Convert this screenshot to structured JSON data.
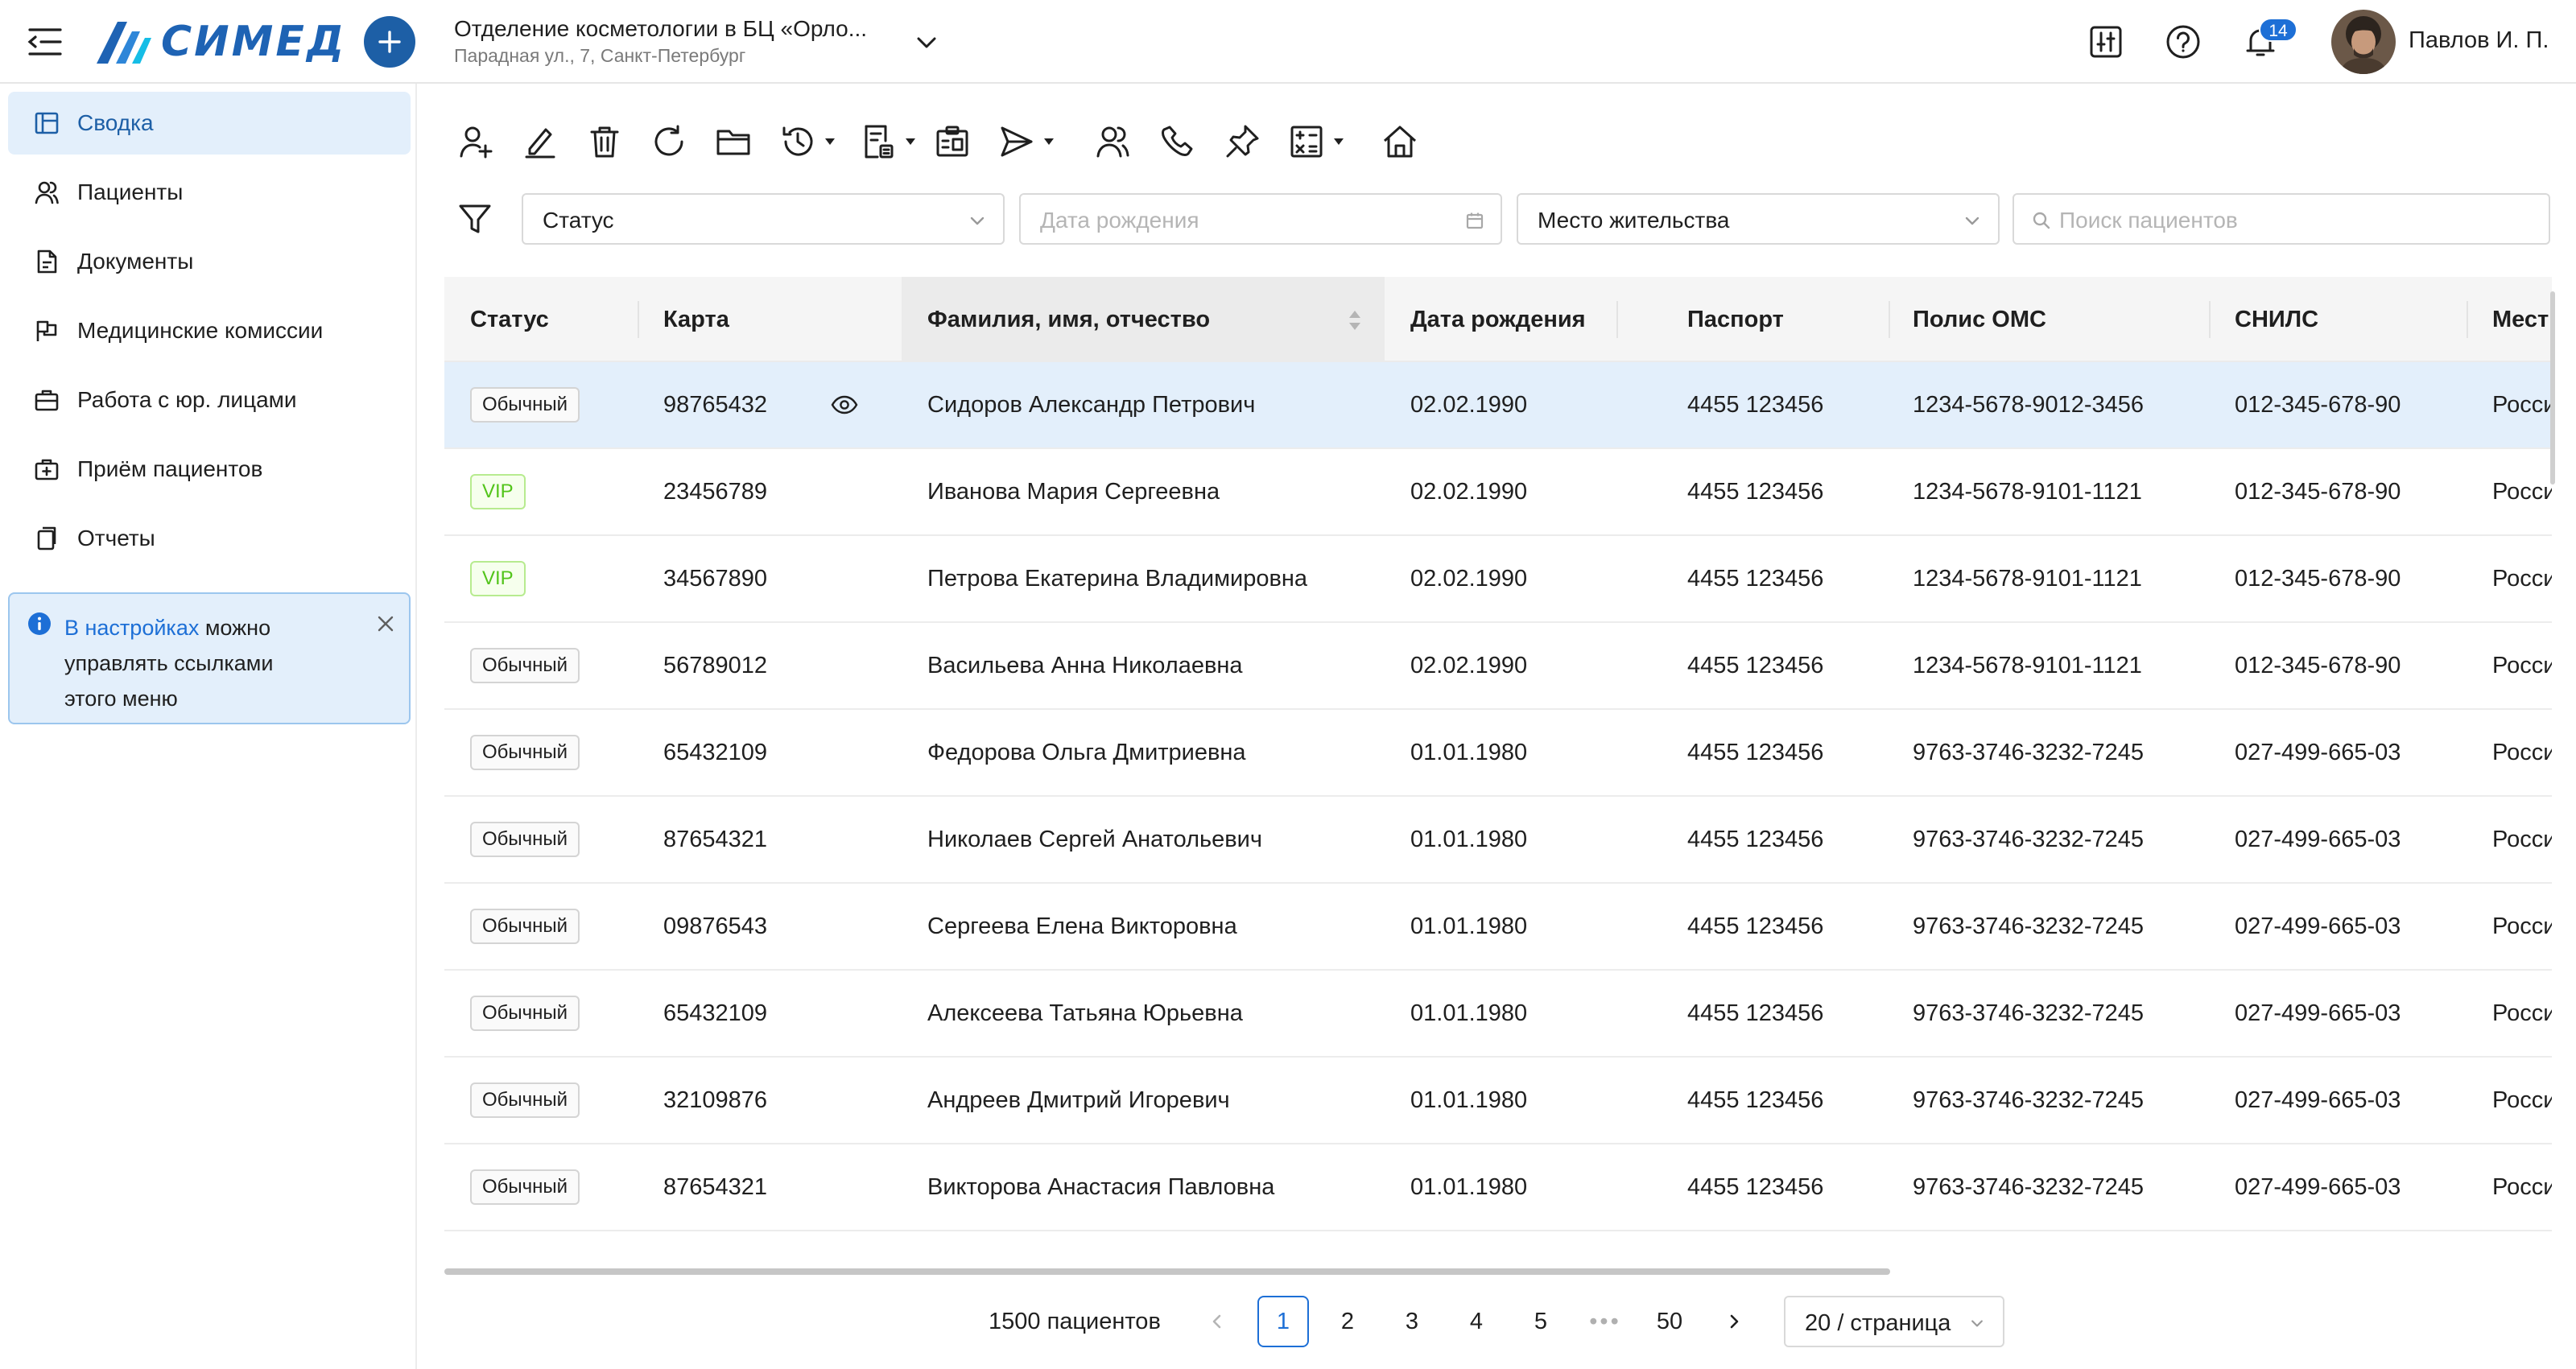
{
  "app": {
    "logo_text": "СИМЕД"
  },
  "header": {
    "org_name": "Отделение косметологии в БЦ «Орло...",
    "org_address": "Парадная ул., 7, Санкт-Петербург",
    "notifications_count": "14",
    "user_name": "Павлов И. П."
  },
  "sidebar": {
    "items": [
      {
        "label": "Сводка",
        "icon": "layout-icon"
      },
      {
        "label": "Пациенты",
        "icon": "patients-icon"
      },
      {
        "label": "Документы",
        "icon": "document-icon"
      },
      {
        "label": "Медицинские комиссии",
        "icon": "commission-icon"
      },
      {
        "label": "Работа с юр. лицами",
        "icon": "briefcase-icon"
      },
      {
        "label": "Приём пациентов",
        "icon": "medkit-icon"
      },
      {
        "label": "Отчеты",
        "icon": "reports-icon"
      }
    ],
    "info": {
      "link_text": "В настройках",
      "text": " можно управлять ссылками этого меню"
    }
  },
  "toolbar": {
    "icons": [
      "add-user-icon",
      "edit-icon",
      "delete-icon",
      "refresh-icon",
      "folder-icon",
      "history-icon",
      "document-list-icon",
      "clipboard-icon",
      "send-icon",
      "users-icon",
      "phone-icon",
      "pin-icon",
      "calculator-icon",
      "home-icon"
    ]
  },
  "filters": {
    "status_placeholder": "Статус",
    "birthdate_placeholder": "Дата рождения",
    "residence_placeholder": "Место жительства",
    "search_placeholder": "Поиск пациентов"
  },
  "table": {
    "columns": [
      "Статус",
      "Карта",
      "Фамилия, имя, отчество",
      "Дата рождения",
      "Паспорт",
      "Полис ОМС",
      "СНИЛС",
      "Мест"
    ],
    "rows": [
      {
        "status": "Обычный",
        "vip": false,
        "card": "98765432",
        "name": "Сидоров Александр Петрович",
        "birth": "02.02.1990",
        "passport": "4455 123456",
        "oms": "1234-5678-9012-3456",
        "snils": "012-345-678-90",
        "place": "Росси"
      },
      {
        "status": "VIP",
        "vip": true,
        "card": "23456789",
        "name": "Иванова Мария Сергеевна",
        "birth": "02.02.1990",
        "passport": "4455 123456",
        "oms": "1234-5678-9101-1121",
        "snils": "012-345-678-90",
        "place": "Росси"
      },
      {
        "status": "VIP",
        "vip": true,
        "card": "34567890",
        "name": "Петрова Екатерина Владимировна",
        "birth": "02.02.1990",
        "passport": "4455 123456",
        "oms": "1234-5678-9101-1121",
        "snils": "012-345-678-90",
        "place": "Росси"
      },
      {
        "status": "Обычный",
        "vip": false,
        "card": "56789012",
        "name": "Васильева Анна Николаевна",
        "birth": "02.02.1990",
        "passport": "4455 123456",
        "oms": "1234-5678-9101-1121",
        "snils": "012-345-678-90",
        "place": "Росси"
      },
      {
        "status": "Обычный",
        "vip": false,
        "card": "65432109",
        "name": "Федорова Ольга Дмитриевна",
        "birth": "01.01.1980",
        "passport": "4455 123456",
        "oms": "9763-3746-3232-7245",
        "snils": "027-499-665-03",
        "place": "Росси"
      },
      {
        "status": "Обычный",
        "vip": false,
        "card": "87654321",
        "name": "Николаев Сергей Анатольевич",
        "birth": "01.01.1980",
        "passport": "4455 123456",
        "oms": "9763-3746-3232-7245",
        "snils": "027-499-665-03",
        "place": "Росси"
      },
      {
        "status": "Обычный",
        "vip": false,
        "card": "09876543",
        "name": "Сергеева Елена Викторовна",
        "birth": "01.01.1980",
        "passport": "4455 123456",
        "oms": "9763-3746-3232-7245",
        "snils": "027-499-665-03",
        "place": "Росси"
      },
      {
        "status": "Обычный",
        "vip": false,
        "card": "65432109",
        "name": "Алексеева Татьяна Юрьевна",
        "birth": "01.01.1980",
        "passport": "4455 123456",
        "oms": "9763-3746-3232-7245",
        "snils": "027-499-665-03",
        "place": "Росси"
      },
      {
        "status": "Обычный",
        "vip": false,
        "card": "32109876",
        "name": "Андреев Дмитрий Игоревич",
        "birth": "01.01.1980",
        "passport": "4455 123456",
        "oms": "9763-3746-3232-7245",
        "snils": "027-499-665-03",
        "place": "Росси"
      },
      {
        "status": "Обычный",
        "vip": false,
        "card": "87654321",
        "name": "Викторова Анастасия Павловна",
        "birth": "01.01.1980",
        "passport": "4455 123456",
        "oms": "9763-3746-3232-7245",
        "snils": "027-499-665-03",
        "place": "Росси"
      }
    ]
  },
  "pagination": {
    "total": "1500 пациентов",
    "pages": [
      "1",
      "2",
      "3",
      "4",
      "5"
    ],
    "ellipsis": "•••",
    "last_page": "50",
    "current": "1",
    "page_size": "20 / страница"
  },
  "colors": {
    "brand": "#1d5fa6",
    "accent": "#1d6fd6",
    "selected_row": "#e3effb",
    "vip": "#52c41a"
  }
}
